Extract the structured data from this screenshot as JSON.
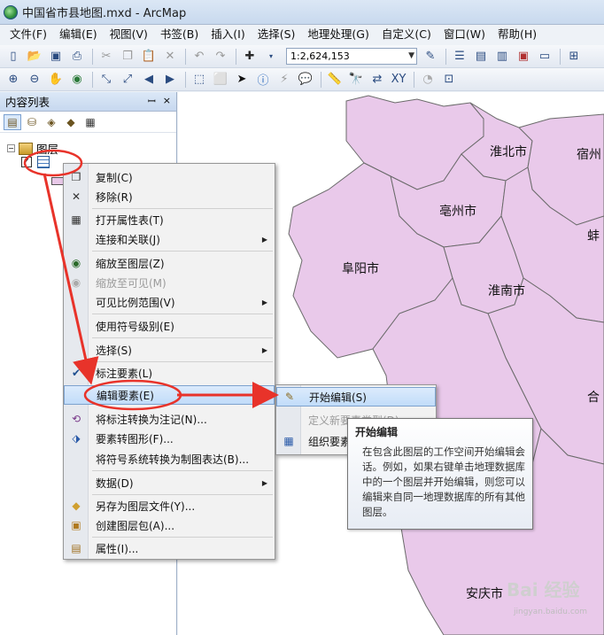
{
  "window": {
    "title": "中国省市县地图.mxd - ArcMap"
  },
  "menubar": [
    "文件(F)",
    "编辑(E)",
    "视图(V)",
    "书签(B)",
    "插入(I)",
    "选择(S)",
    "地理处理(G)",
    "自定义(C)",
    "窗口(W)",
    "帮助(H)"
  ],
  "toolbar": {
    "scale_value": "1:2,624,153"
  },
  "toc": {
    "title": "内容列表",
    "pin_glyph": "ꟷ",
    "close_glyph": "×",
    "layers_root": "图层",
    "layer_checked": "✓"
  },
  "map": {
    "fill_color": "#e9c9ea",
    "border_color": "#6b6b6b",
    "labels": [
      "淮北市",
      "宿州",
      "亳州市",
      "蚌",
      "阜阳市",
      "淮南市",
      "合",
      "安庆市"
    ]
  },
  "context_menu": {
    "items": [
      {
        "icon": "copy-icon",
        "label": "复制(C)"
      },
      {
        "icon": "remove-icon",
        "label": "移除(R)"
      },
      {
        "icon": "table-icon",
        "label": "打开属性表(T)"
      },
      {
        "icon": "",
        "label": "连接和关联(J)",
        "submenu": true
      },
      {
        "icon": "zoom-layer-icon",
        "label": "缩放至图层(Z)"
      },
      {
        "icon": "zoom-visible-icon",
        "label": "缩放至可见(M)",
        "disabled": true
      },
      {
        "icon": "",
        "label": "可见比例范围(V)",
        "submenu": true
      },
      {
        "icon": "",
        "label": "使用符号级别(E)"
      },
      {
        "icon": "",
        "label": "选择(S)",
        "submenu": true
      },
      {
        "icon": "check-icon",
        "label": "标注要素(L)"
      },
      {
        "icon": "",
        "label": "编辑要素(E)",
        "submenu": true,
        "highlight": true
      },
      {
        "icon": "convert-annotation-icon",
        "label": "将标注转换为注记(N)..."
      },
      {
        "icon": "convert-graphics-icon",
        "label": "要素转图形(F)..."
      },
      {
        "icon": "",
        "label": "将符号系统转换为制图表达(B)..."
      },
      {
        "icon": "",
        "label": "数据(D)",
        "submenu": true
      },
      {
        "icon": "layer-file-icon",
        "label": "另存为图层文件(Y)..."
      },
      {
        "icon": "layer-package-icon",
        "label": "创建图层包(A)..."
      },
      {
        "icon": "properties-icon",
        "label": "属性(I)..."
      }
    ],
    "arrow_glyph": "▶",
    "check_glyph": "✔"
  },
  "submenu": {
    "items": [
      {
        "label": "开始编辑(S)",
        "highlight": true
      },
      {
        "label": "定义新要素类型(D)",
        "disabled": true
      },
      {
        "label": "组织要素模板(O)"
      }
    ]
  },
  "tooltip": {
    "title": "开始编辑",
    "body": "在包含此图层的工作空间开始编辑会话。例如，如果右键单击地理数据库中的一个图层并开始编辑，则您可以编辑来自同一地理数据库的所有其他图层。"
  },
  "watermark": {
    "logo": "Bai 经验",
    "site": "jingyan.baidu.com"
  },
  "annotation_color": "#e8332a"
}
